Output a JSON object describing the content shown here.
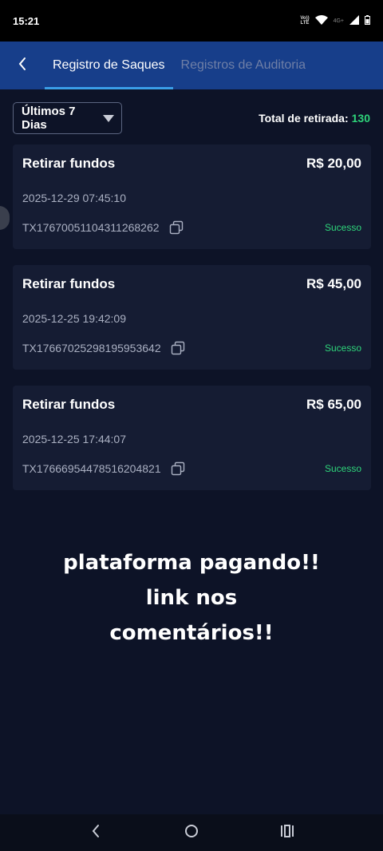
{
  "status_bar": {
    "time": "15:21",
    "volte_label_top": "Vo))",
    "volte_label_bottom": "LTE",
    "network_label": "4G+"
  },
  "header": {
    "tabs": [
      {
        "label": "Registro de Saques",
        "active": true
      },
      {
        "label": "Registros de Auditoria",
        "active": false
      }
    ]
  },
  "filter": {
    "selected": "Últimos 7 Dias",
    "total_label": "Total de retirada:",
    "total_value": "130"
  },
  "withdrawals": [
    {
      "title": "Retirar fundos",
      "amount": "R$ 20,00",
      "datetime": "2025-12-29 07:45:10",
      "tx": "TX1767005110431126826­2",
      "status": "Sucesso"
    },
    {
      "title": "Retirar fundos",
      "amount": "R$ 45,00",
      "datetime": "2025-12-25 19:42:09",
      "tx": "TX17667025298195953642",
      "status": "Sucesso"
    },
    {
      "title": "Retirar fundos",
      "amount": "R$ 65,00",
      "datetime": "2025-12-25 17:44:07",
      "tx": "TX17666954478516204821",
      "status": "Sucesso"
    }
  ],
  "overlay_text": {
    "line1": "plataforma pagando!!",
    "line2": "link nos",
    "line3": "comentários!!"
  },
  "colors": {
    "background": "#0d1327",
    "header": "#173e8a",
    "card": "#151c33",
    "success": "#2ed47a",
    "tab_indicator": "#3a9ee8"
  },
  "icons": {
    "back": "chevron-left-icon",
    "dropdown": "caret-down-icon",
    "copy": "copy-icon",
    "nav_back": "nav-back-icon",
    "nav_home": "nav-home-icon",
    "nav_recents": "nav-recents-icon"
  }
}
